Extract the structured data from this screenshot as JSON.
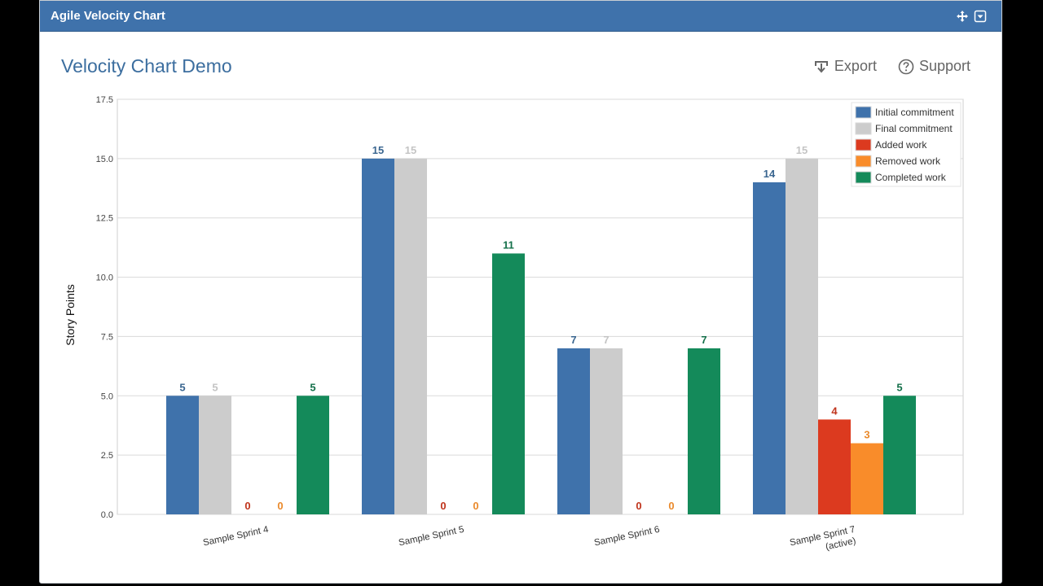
{
  "header": {
    "title": "Agile Velocity Chart",
    "icons": [
      "move-icon",
      "dropdown-icon"
    ]
  },
  "chart_title": "Velocity Chart Demo",
  "toolbar": {
    "export_label": "Export",
    "support_label": "Support"
  },
  "chart_data": {
    "type": "bar",
    "title": "Velocity Chart Demo",
    "xlabel": "",
    "ylabel": "Story Points",
    "ylim": [
      0,
      17.5
    ],
    "yticks": [
      "0.0",
      "2.5",
      "5.0",
      "7.5",
      "10.0",
      "12.5",
      "15.0",
      "17.5"
    ],
    "ytick_values": [
      0,
      2.5,
      5,
      7.5,
      10,
      12.5,
      15,
      17.5
    ],
    "grid": true,
    "legend_position": "top-right",
    "categories": [
      [
        "Sample Sprint 4"
      ],
      [
        "Sample Sprint 5"
      ],
      [
        "Sample Sprint 6"
      ],
      [
        "Sample Sprint 7",
        "(active)"
      ]
    ],
    "series": [
      {
        "name": "Initial commitment",
        "color": "#3f72ab",
        "label_color": "#3a6690",
        "values": [
          5,
          15,
          7,
          14
        ]
      },
      {
        "name": "Final commitment",
        "color": "#cccccc",
        "label_color": "#c4c4c4",
        "values": [
          5,
          15,
          7,
          15
        ]
      },
      {
        "name": "Added work",
        "color": "#dc3a1f",
        "label_color": "#c0341c",
        "values": [
          0,
          0,
          0,
          4
        ]
      },
      {
        "name": "Removed work",
        "color": "#f98c2a",
        "label_color": "#ea8a2c",
        "values": [
          0,
          0,
          0,
          3
        ]
      },
      {
        "name": "Completed work",
        "color": "#148a5a",
        "label_color": "#14704a",
        "values": [
          5,
          11,
          7,
          5
        ]
      }
    ]
  }
}
